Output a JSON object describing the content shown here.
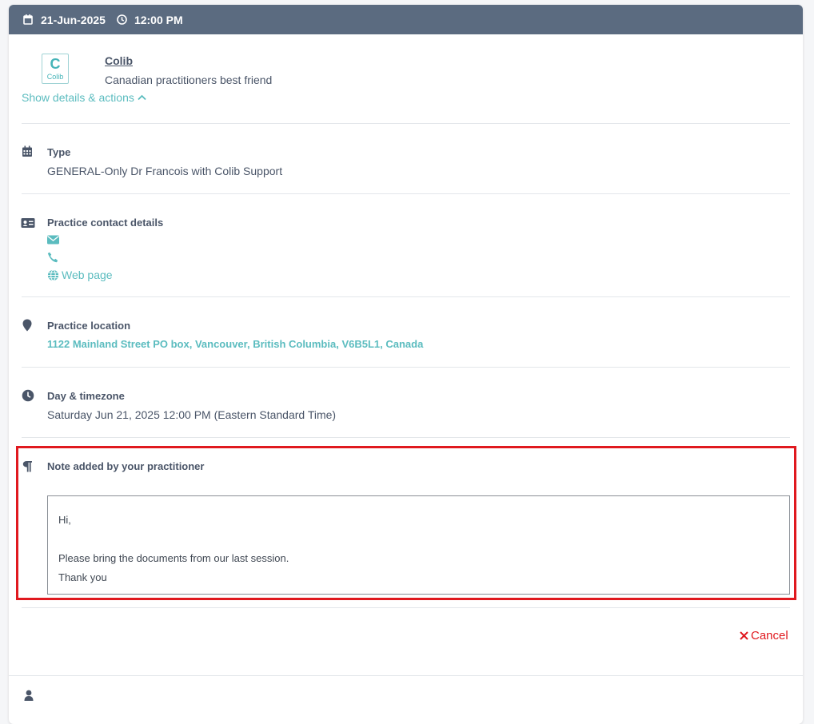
{
  "header": {
    "date": "21-Jun-2025",
    "time": "12:00 PM",
    "calendar_icon": "calendar-icon",
    "clock_icon": "clock-icon"
  },
  "company": {
    "logo_letter": "C",
    "logo_text": "Colib",
    "name": "Colib",
    "description": "Canadian practitioners best friend",
    "toggle_label": "Show details & actions"
  },
  "sections": {
    "type": {
      "title": "Type",
      "value": "GENERAL-Only Dr Francois with Colib Support"
    },
    "contact": {
      "title": "Practice contact details",
      "web_label": "Web page"
    },
    "location": {
      "title": "Practice location",
      "address": "1122 Mainland Street PO box, Vancouver, British Columbia, V6B5L1, Canada"
    },
    "day": {
      "title": "Day & timezone",
      "value": "Saturday Jun 21, 2025 12:00 PM (Eastern Standard Time)"
    },
    "note": {
      "title": "Note added by your practitioner",
      "line1": "Hi,",
      "line2": "Please bring the documents from our last session.",
      "line3": "Thank you"
    }
  },
  "actions": {
    "cancel_label": "Cancel"
  },
  "colors": {
    "header_bg": "#5b6b80",
    "accent_teal": "#5bbcbf",
    "danger_red": "#e0191f",
    "text": "#4a5568"
  }
}
